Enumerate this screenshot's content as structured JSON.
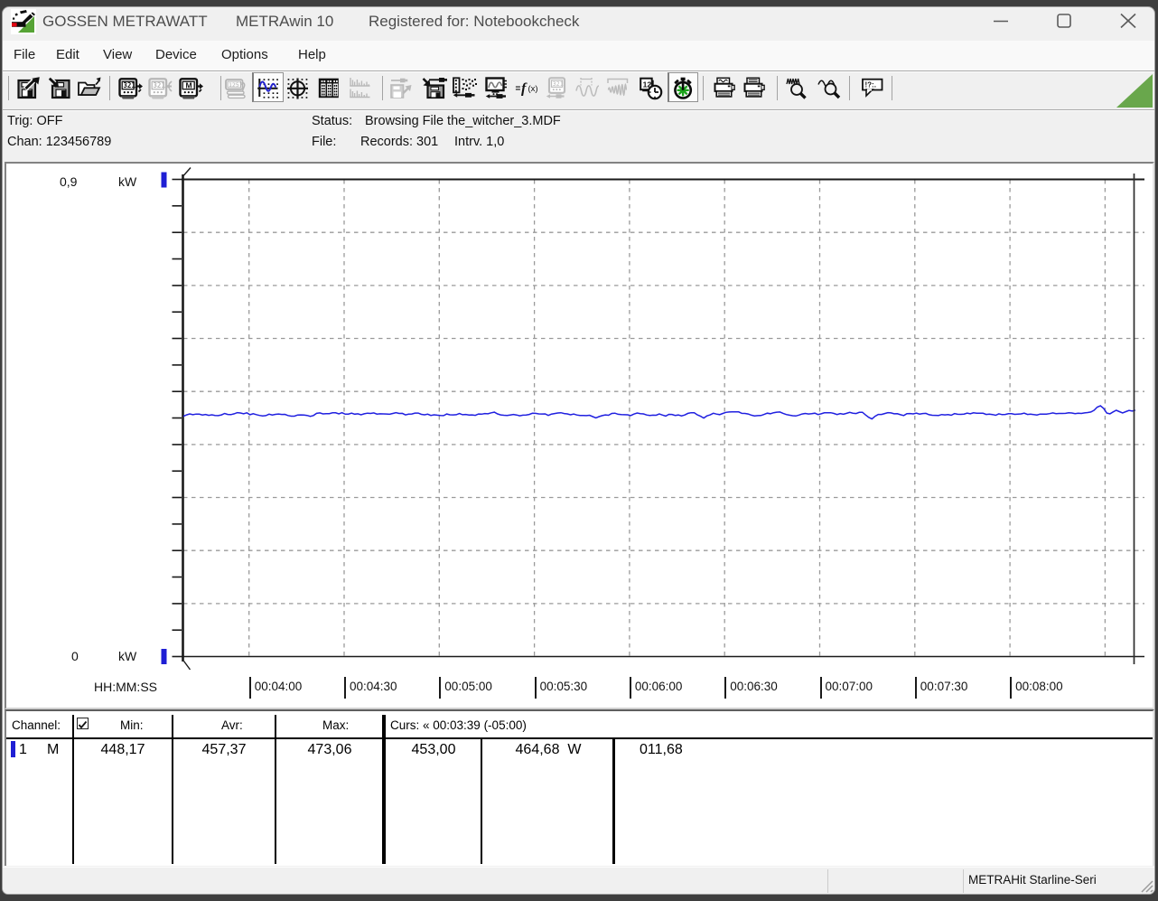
{
  "window": {
    "app_title": "GOSSEN METRAWATT",
    "app_name": "METRAwin 10",
    "registered": "Registered for: Notebookcheck",
    "controls": [
      "minimize",
      "maximize",
      "close"
    ]
  },
  "menu": {
    "items": [
      {
        "label": "File"
      },
      {
        "label": "Edit"
      },
      {
        "label": "View"
      },
      {
        "label": "Device"
      },
      {
        "label": "Options"
      },
      {
        "label": "Help"
      }
    ]
  },
  "toolbar": {
    "buttons": [
      {
        "name": "save-export",
        "icon": "floppy-arrow-out-icon",
        "disabled": false
      },
      {
        "name": "save-import",
        "icon": "floppy-arrow-in-icon",
        "disabled": false
      },
      {
        "name": "open-file",
        "icon": "open-folder-icon",
        "disabled": false
      },
      {
        "name": "read-device",
        "icon": "meter-321-arrow-out-icon",
        "disabled": false
      },
      {
        "name": "write-device",
        "icon": "meter-321-arrow-in-icon",
        "disabled": true
      },
      {
        "name": "read-memory",
        "icon": "meter-m-arrow-out-icon",
        "disabled": false
      },
      {
        "name": "numeric-view",
        "icon": "multi-display-1257-icon",
        "disabled": true
      },
      {
        "name": "yt-chart-view",
        "icon": "yt-curve-icon",
        "disabled": false,
        "active": true
      },
      {
        "name": "xy-view",
        "icon": "crosshair-circle-icon",
        "disabled": false
      },
      {
        "name": "table-view",
        "icon": "data-table-icon",
        "disabled": false
      },
      {
        "name": "histogram-view",
        "icon": "histogram-icon",
        "disabled": true
      },
      {
        "name": "export-file",
        "icon": "floppy-cable-out-icon",
        "disabled": true
      },
      {
        "name": "record-to-file",
        "icon": "floppy-cable-in-icon",
        "disabled": false
      },
      {
        "name": "channel-settings",
        "icon": "channel-list-icon",
        "disabled": false
      },
      {
        "name": "live-display",
        "icon": "monitor-wave-icon",
        "disabled": false
      },
      {
        "name": "formula",
        "icon": "fx-formula-icon",
        "disabled": false
      },
      {
        "name": "device-settings",
        "icon": "meter-cable-icon",
        "disabled": true
      },
      {
        "name": "sine-cursors",
        "icon": "sine-markers-icon",
        "disabled": true
      },
      {
        "name": "damped-wave",
        "icon": "damped-oscillation-icon",
        "disabled": true
      },
      {
        "name": "absolute-time",
        "icon": "calendar-clock-icon",
        "disabled": false
      },
      {
        "name": "relative-time",
        "icon": "green-stopwatch-icon",
        "disabled": false,
        "active": true
      },
      {
        "name": "print-chart",
        "icon": "printer-curve-icon",
        "disabled": false
      },
      {
        "name": "print-data",
        "icon": "printer-lines-icon",
        "disabled": false
      },
      {
        "name": "zoom-in-time",
        "icon": "magnifier-compressed-wave-icon",
        "disabled": false
      },
      {
        "name": "zoom-out-time",
        "icon": "magnifier-wide-wave-icon",
        "disabled": false
      },
      {
        "name": "notes",
        "icon": "speech-bubble-icon",
        "disabled": false
      }
    ]
  },
  "status_panel": {
    "trig_label": "Trig:",
    "trig_value": "OFF",
    "chan_label": "Chan:",
    "chan_value": "123456789",
    "status_label": "Status:",
    "status_value": "Browsing File the_witcher_3.MDF",
    "file_label": "File:",
    "file_records": "Records: 301",
    "file_interval": "Intrv. 1,0"
  },
  "chart": {
    "y_top_label": "0,9",
    "y_bottom_label": "0",
    "y_unit": "kW",
    "x_axis_label": "HH:MM:SS",
    "x_ticks": [
      {
        "label": "00:04:00"
      },
      {
        "label": "00:04:30"
      },
      {
        "label": "00:05:00"
      },
      {
        "label": "00:05:30"
      },
      {
        "label": "00:06:00"
      },
      {
        "label": "00:06:30"
      },
      {
        "label": "00:07:00"
      },
      {
        "label": "00:07:30"
      },
      {
        "label": "00:08:00"
      }
    ]
  },
  "chart_data": {
    "type": "line",
    "title": "",
    "xlabel": "HH:MM:SS",
    "ylabel": "kW",
    "ylim": [
      0,
      0.9
    ],
    "x_start": "00:03:39",
    "x_end": "00:08:40",
    "x_tick_labels": [
      "00:04:00",
      "00:04:30",
      "00:05:00",
      "00:05:30",
      "00:06:00",
      "00:06:30",
      "00:07:00",
      "00:07:30",
      "00:08:00"
    ],
    "grid": true,
    "sample_interval_s": 1,
    "records": 301,
    "unit": "W",
    "series": [
      {
        "name": "Channel 1 power (W)",
        "color": "#2020e0",
        "values": [
          453.0,
          455.72,
          457.68,
          456.09,
          457.37,
          457.18,
          455.56,
          456.68,
          455.02,
          455.95,
          454.79,
          454.36,
          455.78,
          458.48,
          456.73,
          456.3,
          457.9,
          460.09,
          459.36,
          457.95,
          459.69,
          456.16,
          457.95,
          456.23,
          454.7,
          453.86,
          454.41,
          457.12,
          455.67,
          456.78,
          457.57,
          456.66,
          456.88,
          454.65,
          453.41,
          453.41,
          455.65,
          455.78,
          455.49,
          454.79,
          453.05,
          454.63,
          458.77,
          459.48,
          457.71,
          458.23,
          458.17,
          459.66,
          459.72,
          457.73,
          459.94,
          457.23,
          457.32,
          459.04,
          457.22,
          457.83,
          456.01,
          457.83,
          459.04,
          458.59,
          459.56,
          457.34,
          457.87,
          457.66,
          457.54,
          456.99,
          458.56,
          459.94,
          458.52,
          458.63,
          455.84,
          457.21,
          457.55,
          459.21,
          459.22,
          456.76,
          456.02,
          457.08,
          454.84,
          455.89,
          455.26,
          454.83,
          454.4,
          457.44,
          456.03,
          455.75,
          456.18,
          458.55,
          456.13,
          456.61,
          455.58,
          455.83,
          454.91,
          457.54,
          457.14,
          458.43,
          457.81,
          459.75,
          460.91,
          457.62,
          455.85,
          455.07,
          454.62,
          455.55,
          456.58,
          455.7,
          454.13,
          455.27,
          455.64,
          456.68,
          458.89,
          458.69,
          457.65,
          457.47,
          457.6,
          454.83,
          457.38,
          458.3,
          459.41,
          459.81,
          458.32,
          457.67,
          456.02,
          457.58,
          455.69,
          454.65,
          454.68,
          454.45,
          455.17,
          452.54,
          450.22,
          452.51,
          454.45,
          455.86,
          455.07,
          458.53,
          459.03,
          456.99,
          456.22,
          456.08,
          455.93,
          454.66,
          457.31,
          459.38,
          458.11,
          457.61,
          455.58,
          454.63,
          455.2,
          455.05,
          457.43,
          455.45,
          453.64,
          456.88,
          456.58,
          454.72,
          455.69,
          453.98,
          455.58,
          458.66,
          459.86,
          459.79,
          455.77,
          453.16,
          449.85,
          453.87,
          455.77,
          458.84,
          457.39,
          456.24,
          458.5,
          460.63,
          461.27,
          461.47,
          461.66,
          461.34,
          458.69,
          458.49,
          457.46,
          455.26,
          453.99,
          454.42,
          454.56,
          456.67,
          459.06,
          458.04,
          459.8,
          460.94,
          461.32,
          458.67,
          456.48,
          455.21,
          454.27,
          453.74,
          455.38,
          457.57,
          458.56,
          457.58,
          458.04,
          459.11,
          456.48,
          457.81,
          459.63,
          459.94,
          459.87,
          458.51,
          456.4,
          458.13,
          457.02,
          458.73,
          460.57,
          459.04,
          458.4,
          460.65,
          460.8,
          455.59,
          451.27,
          448.17,
          453.18,
          456.72,
          456.71,
          458.42,
          460.05,
          459.47,
          457.84,
          457.96,
          456.12,
          454.59,
          458.1,
          458.29,
          457.66,
          459.04,
          457.33,
          458.39,
          458.74,
          456.17,
          455.16,
          454.98,
          454.81,
          456.44,
          455.86,
          456.3,
          455.17,
          458.1,
          456.98,
          456.83,
          457.32,
          459.1,
          457.92,
          459.75,
          458.97,
          458.86,
          458.89,
          456.64,
          457.39,
          456.51,
          455.09,
          457.85,
          456.25,
          456.69,
          458.02,
          457.94,
          456.88,
          457.29,
          457.75,
          459.09,
          456.66,
          457.41,
          456.25,
          455.6,
          457.36,
          457.08,
          457.15,
          458.14,
          459.47,
          458.18,
          458.52,
          458.44,
          458.66,
          459.79,
          459.4,
          458.2,
          459.0,
          458.5,
          459.5,
          460.2,
          461.2,
          464.5,
          470.5,
          473.06,
          468.0,
          459.2,
          457.8,
          461.5,
          464.5,
          462.0,
          459.5,
          462.0,
          464.2,
          463.0,
          464.68
        ]
      }
    ],
    "cursor_time": "00:08:40",
    "stats": {
      "min": 448.17,
      "avr": 457.37,
      "max": 473.06
    }
  },
  "table": {
    "headers": {
      "channel": "Channel:",
      "min": "Min:",
      "avr": "Avr:",
      "max": "Max:",
      "curs": "Curs: « 00:03:39 (-05:00)"
    },
    "row": {
      "num": "1",
      "mode": "M",
      "checked": true,
      "min": "448,17",
      "avr": "457,37",
      "max": "473,06",
      "curs_a": "453,00",
      "curs_b": "464,68",
      "curs_b_unit": "W",
      "curs_delta": "011,68"
    }
  },
  "statusbar": {
    "device": "METRAHit Starline-Seri"
  },
  "colors": {
    "accent_blue": "#2020e0",
    "brand_green": "#69a74c",
    "brand_red": "#e30613",
    "window_bg": "#f0f0f0",
    "chart_bg": "#ffffff"
  }
}
